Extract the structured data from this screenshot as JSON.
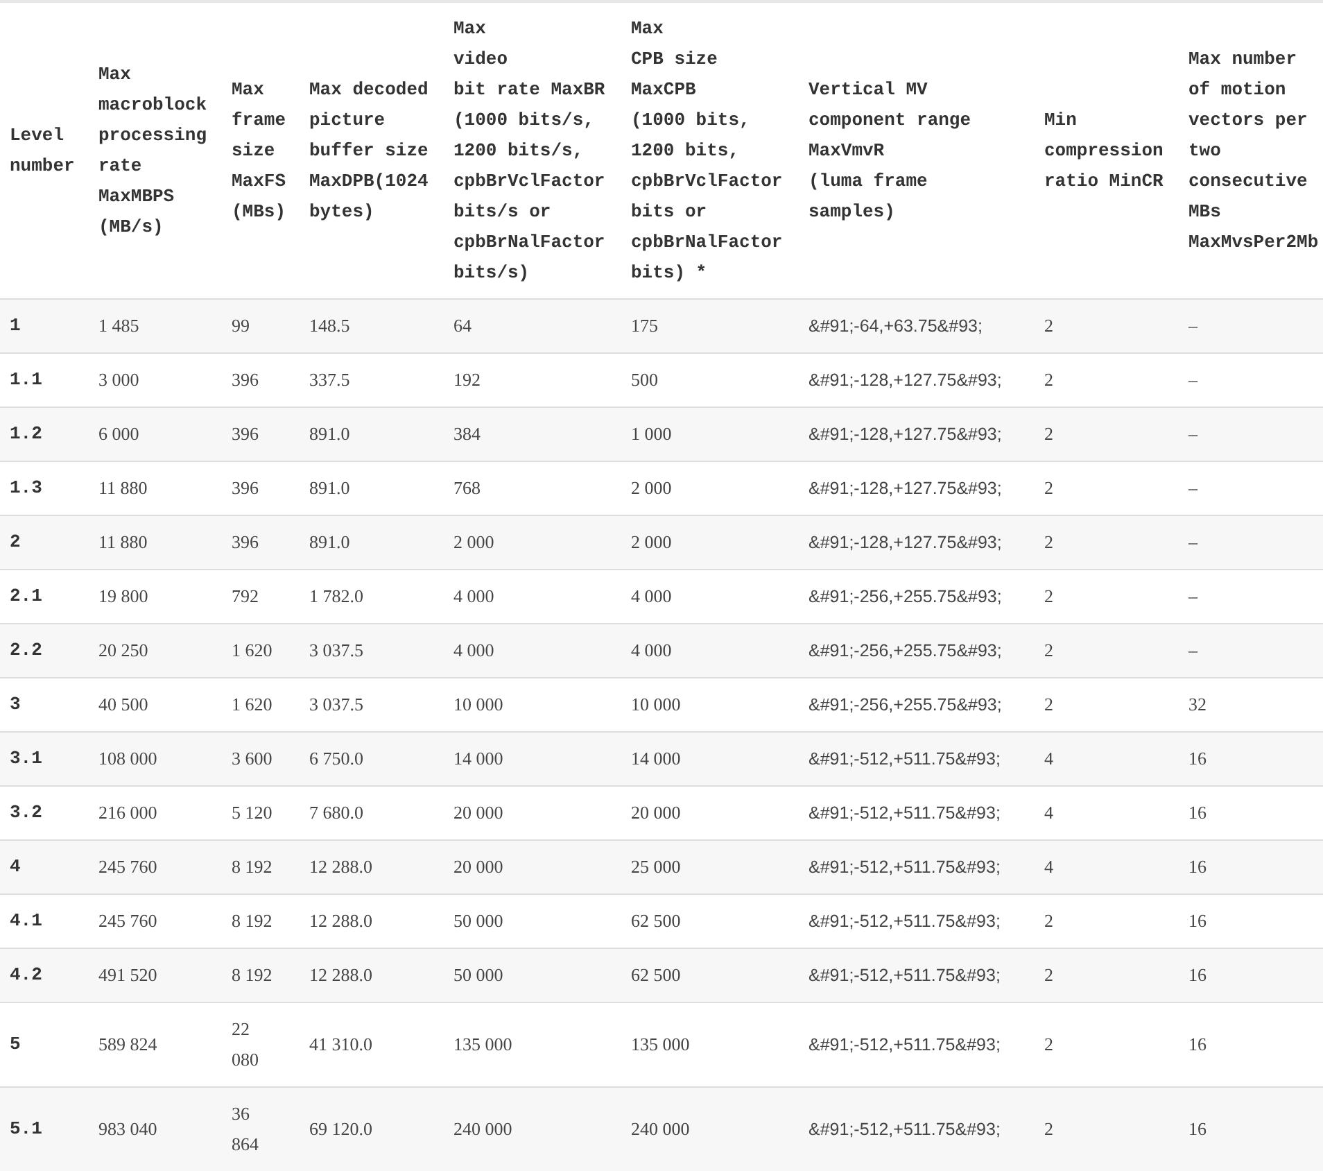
{
  "table": {
    "columns": [
      {
        "lines": [
          "Level",
          "number"
        ]
      },
      {
        "lines": [
          "Max",
          "macroblock",
          "processing",
          "rate",
          "MaxMBPS",
          "(MB/s)"
        ]
      },
      {
        "lines": [
          "Max",
          "frame",
          "size",
          "MaxFS",
          "(MBs)"
        ]
      },
      {
        "lines": [
          "Max decoded",
          "picture",
          "buffer size",
          "MaxDPB(1024",
          "bytes)"
        ]
      },
      {
        "lines": [
          "Max",
          "video",
          "bit rate MaxBR",
          "(1000 bits/s,",
          "1200 bits/s,",
          "cpbBrVclFactor",
          "bits/s or",
          "cpbBrNalFactor",
          "bits/s)"
        ]
      },
      {
        "lines": [
          "Max",
          "CPB size",
          "MaxCPB",
          "(1000 bits,",
          "1200 bits,",
          "cpbBrVclFactor",
          "bits or",
          "cpbBrNalFactor",
          "bits) *"
        ]
      },
      {
        "lines": [
          "Vertical MV",
          "component range",
          "MaxVmvR",
          "(luma frame",
          "samples)"
        ]
      },
      {
        "lines": [
          "Min",
          "compression",
          "ratio MinCR"
        ]
      },
      {
        "lines": [
          "Max number",
          "of motion",
          "vectors per",
          "two",
          "consecutive",
          "MBs",
          "MaxMvsPer2Mb"
        ]
      }
    ],
    "rows": [
      [
        "1",
        "1 485",
        "99",
        "148.5",
        "64",
        "175",
        "&#91;-64,+63.75&#93;",
        "2",
        "–"
      ],
      [
        "1.1",
        "3 000",
        "396",
        "337.5",
        "192",
        "500",
        "&#91;-128,+127.75&#93;",
        "2",
        "–"
      ],
      [
        "1.2",
        "6 000",
        "396",
        "891.0",
        "384",
        "1 000",
        "&#91;-128,+127.75&#93;",
        "2",
        "–"
      ],
      [
        "1.3",
        "11 880",
        "396",
        "891.0",
        "768",
        "2 000",
        "&#91;-128,+127.75&#93;",
        "2",
        "–"
      ],
      [
        "2",
        "11 880",
        "396",
        "891.0",
        "2 000",
        "2 000",
        "&#91;-128,+127.75&#93;",
        "2",
        "–"
      ],
      [
        "2.1",
        "19 800",
        "792",
        "1 782.0",
        "4 000",
        "4 000",
        "&#91;-256,+255.75&#93;",
        "2",
        "–"
      ],
      [
        "2.2",
        "20 250",
        "1 620",
        "3 037.5",
        "4 000",
        "4 000",
        "&#91;-256,+255.75&#93;",
        "2",
        "–"
      ],
      [
        "3",
        "40 500",
        "1 620",
        "3 037.5",
        "10 000",
        "10 000",
        "&#91;-256,+255.75&#93;",
        "2",
        "32"
      ],
      [
        "3.1",
        "108 000",
        "3 600",
        "6 750.0",
        "14 000",
        "14 000",
        "&#91;-512,+511.75&#93;",
        "4",
        "16"
      ],
      [
        "3.2",
        "216 000",
        "5 120",
        "7 680.0",
        "20 000",
        "20 000",
        "&#91;-512,+511.75&#93;",
        "4",
        "16"
      ],
      [
        "4",
        "245 760",
        "8 192",
        "12 288.0",
        "20 000",
        "25 000",
        "&#91;-512,+511.75&#93;",
        "4",
        "16"
      ],
      [
        "4.1",
        "245 760",
        "8 192",
        "12 288.0",
        "50 000",
        "62 500",
        "&#91;-512,+511.75&#93;",
        "2",
        "16"
      ],
      [
        "4.2",
        "491 520",
        "8 192",
        "12 288.0",
        "50 000",
        "62 500",
        "&#91;-512,+511.75&#93;",
        "2",
        "16"
      ],
      [
        "5",
        "589 824",
        "22 080",
        "41 310.0",
        "135 000",
        "135 000",
        "&#91;-512,+511.75&#93;",
        "2",
        "16"
      ],
      [
        "5.1",
        "983 040",
        "36 864",
        "69 120.0",
        "240 000",
        "240 000",
        "&#91;-512,+511.75&#93;",
        "2",
        "16"
      ]
    ]
  }
}
